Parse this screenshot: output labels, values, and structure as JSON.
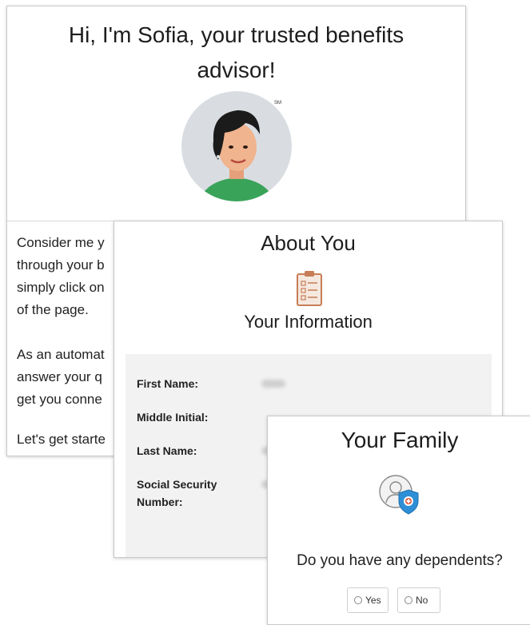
{
  "intro": {
    "title": "Hi, I'm Sofia, your trusted benefits advisor!",
    "service_mark": "SM",
    "paragraphs": [
      "Consider me y",
      "through your b",
      "simply click on",
      "of the page.",
      "As an automat",
      "answer your q",
      "get you conne",
      "Let's get starte"
    ]
  },
  "about": {
    "heading": "About You",
    "subheading": "Your Information",
    "fields": [
      {
        "label": "First Name:"
      },
      {
        "label": "Middle Initial:"
      },
      {
        "label": "Last Name:"
      },
      {
        "label": "Social Security Number:"
      }
    ]
  },
  "family": {
    "heading": "Your Family",
    "question": "Do you have any dependents?",
    "options": [
      "Yes",
      "No"
    ]
  },
  "colors": {
    "avatar_bg": "#d9dde2",
    "shirt": "#3aa35a",
    "clipboard": "#c77d55",
    "shield": "#2e8fd6",
    "panel_bg": "#f2f2f2"
  }
}
